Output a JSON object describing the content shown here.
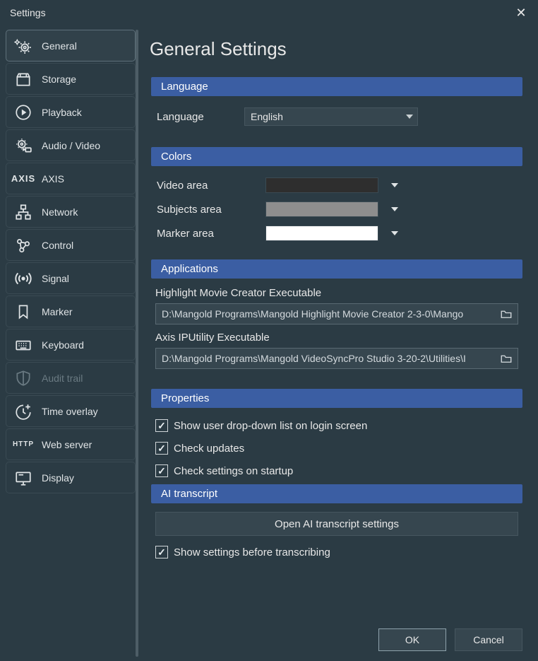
{
  "window": {
    "title": "Settings"
  },
  "sidebar": {
    "items": [
      {
        "id": "general",
        "label": "General",
        "selected": true
      },
      {
        "id": "storage",
        "label": "Storage"
      },
      {
        "id": "playback",
        "label": "Playback"
      },
      {
        "id": "audiovideo",
        "label": "Audio / Video"
      },
      {
        "id": "axis",
        "label": "AXIS"
      },
      {
        "id": "network",
        "label": "Network"
      },
      {
        "id": "control",
        "label": "Control"
      },
      {
        "id": "signal",
        "label": "Signal"
      },
      {
        "id": "marker",
        "label": "Marker"
      },
      {
        "id": "keyboard",
        "label": "Keyboard"
      },
      {
        "id": "audittrail",
        "label": "Audit trail",
        "disabled": true
      },
      {
        "id": "timeoverlay",
        "label": "Time overlay"
      },
      {
        "id": "webserver",
        "label": "Web server"
      },
      {
        "id": "display",
        "label": "Display"
      }
    ]
  },
  "page": {
    "title": "General Settings",
    "sections": {
      "language": {
        "header": "Language",
        "label": "Language",
        "value": "English"
      },
      "colors": {
        "header": "Colors",
        "video_label": "Video area",
        "video_color": "#2e2e2e",
        "subjects_label": "Subjects area",
        "subjects_color": "#8e8e8e",
        "marker_label": "Marker area",
        "marker_color": "#ffffff"
      },
      "applications": {
        "header": "Applications",
        "hmc_label": "Highlight Movie Creator Executable",
        "hmc_path": "D:\\Mangold Programs\\Mangold Highlight Movie Creator 2-3-0\\Mango",
        "axis_label": "Axis IPUtility Executable",
        "axis_path": "D:\\Mangold Programs\\Mangold VideoSyncPro Studio 3-20-2\\Utilities\\I"
      },
      "properties": {
        "header": "Properties",
        "opt1_label": "Show user drop-down list on login screen",
        "opt1_checked": true,
        "opt2_label": "Check updates",
        "opt2_checked": true,
        "opt3_label": "Check settings on startup",
        "opt3_checked": true
      },
      "ai": {
        "header": "AI transcript",
        "button_label": "Open AI transcript settings",
        "opt_label": "Show settings before transcribing",
        "opt_checked": true
      }
    },
    "footer": {
      "ok": "OK",
      "cancel": "Cancel"
    }
  }
}
